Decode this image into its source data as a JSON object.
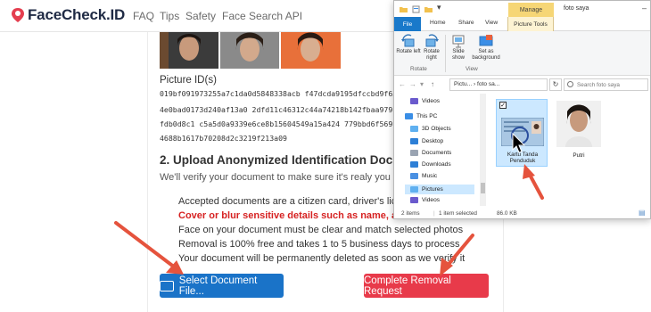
{
  "site": {
    "logo_text": "FaceCheck.ID",
    "nav": [
      "FAQ",
      "Tips",
      "Safety",
      "Face Search API"
    ]
  },
  "content": {
    "picture_ids_label": "Picture ID(s)",
    "hash_lines": [
      "019bf091973255a7c1da0d5848338acb f47dcda9195dfccbd9f65d95",
      "4e0bad0173d240af13a0 2dfd11c46312c44a74218b142fbaa979 3b",
      "fdb0d8c1 c5a5d0a9339e6ce8b15604549a15a424 779bbd6f569b14",
      "4688b1617b70208d2c3219f213a09"
    ],
    "section_title": "2. Upload Anonymized Identification Document",
    "section_subtitle": "We'll verify your document to make sure it's realy you or",
    "bullets": [
      {
        "text": "Accepted documents are a citizen card, driver's licer",
        "warn": false
      },
      {
        "text": "Cover or blur sensitive details such as name, addr",
        "warn": true
      },
      {
        "text": "Face on your document must be clear and match selected photos",
        "warn": false
      },
      {
        "text": "Removal is 100% free and takes 1 to 5 business days to process",
        "warn": false
      },
      {
        "text": "Your document will be permanently deleted as soon as we verify it",
        "warn": false
      }
    ],
    "select_button": "Select Document File...",
    "removal_button": "Complete Removal Request"
  },
  "explorer": {
    "manage_tab": "Manage",
    "title": "foto saya",
    "tabs": [
      "File",
      "Home",
      "Share",
      "View",
      "Picture Tools"
    ],
    "ribbon": {
      "rotate_left": "Rotate left",
      "rotate_right": "Rotate right",
      "slide_show": "Slide show",
      "set_as_background": "Set as background",
      "group_rotate": "Rotate",
      "group_view": "View"
    },
    "address": "Pictu... › foto sa...",
    "search_placeholder": "Search foto saya",
    "nav_items": [
      {
        "label": "Videos",
        "icon_color": "#6a5acd",
        "selected": false
      },
      {
        "label": "This PC",
        "icon_color": "#3a8ee6",
        "selected": false
      },
      {
        "label": "3D Objects",
        "icon_color": "#5fb0f0",
        "selected": false
      },
      {
        "label": "Desktop",
        "icon_color": "#2d7fd6",
        "selected": false
      },
      {
        "label": "Documents",
        "icon_color": "#9aa4b2",
        "selected": false
      },
      {
        "label": "Downloads",
        "icon_color": "#2d7fd6",
        "selected": false
      },
      {
        "label": "Music",
        "icon_color": "#4a90e2",
        "selected": false
      },
      {
        "label": "Pictures",
        "icon_color": "#5fb0f0",
        "selected": true
      },
      {
        "label": "Videos",
        "icon_color": "#6a5acd",
        "selected": false
      }
    ],
    "files": [
      {
        "name": "Kartu Tanda Penduduk",
        "selected": true
      },
      {
        "name": "Putri",
        "selected": false
      }
    ],
    "status": {
      "items": "2 items",
      "selected": "1 item selected",
      "size": "86.0 KB"
    }
  },
  "colors": {
    "brand": "#1f2a44",
    "primary_button": "#1a73c8",
    "danger_button": "#e83a4a",
    "warning_text": "#d62222",
    "arrow": "#e5533d",
    "file_tab": "#1979ca",
    "manage_tab": "#f6d676"
  }
}
